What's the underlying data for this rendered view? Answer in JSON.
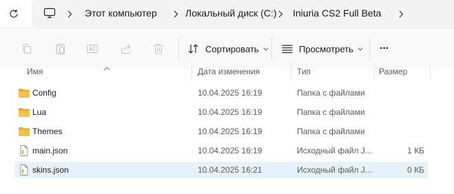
{
  "address": {
    "refresh_icon": "refresh-icon",
    "pc_icon": "computer-icon",
    "breadcrumbs": [
      "Этот компьютер",
      "Локальный диск (C:)",
      "Iniuria CS2 Full Beta"
    ]
  },
  "toolbar": {
    "copy_icon": "copy-icon",
    "paste_icon": "paste-icon",
    "rename_icon": "rename-icon",
    "share_icon": "share-icon",
    "delete_icon": "delete-icon",
    "sort_label": "Сортировать",
    "view_label": "Просмотреть",
    "more_label": "···"
  },
  "columns": {
    "name": "Имя",
    "date": "Дата изменения",
    "type": "Тип",
    "size": "Размер"
  },
  "files": [
    {
      "name": "Config",
      "date": "10.04.2025 16:19",
      "type": "Папка с файлами",
      "size": "",
      "kind": "folder"
    },
    {
      "name": "Lua",
      "date": "10.04.2025 16:19",
      "type": "Папка с файлами",
      "size": "",
      "kind": "folder"
    },
    {
      "name": "Themes",
      "date": "10.04.2025 16:19",
      "type": "Папка с файлами",
      "size": "",
      "kind": "folder"
    },
    {
      "name": "main.json",
      "date": "10.04.2025 16:19",
      "type": "Исходный файл J...",
      "size": "1 КБ",
      "kind": "json"
    },
    {
      "name": "skins.json",
      "date": "10.04.2025 16:21",
      "type": "Исходный файл J...",
      "size": "0 КБ",
      "kind": "json",
      "selected": true
    }
  ],
  "colors": {
    "folder": "#f8c14a",
    "folder_dark": "#e8a92b",
    "selected_row": "#e5f1fb",
    "accent": "#0067c0"
  }
}
